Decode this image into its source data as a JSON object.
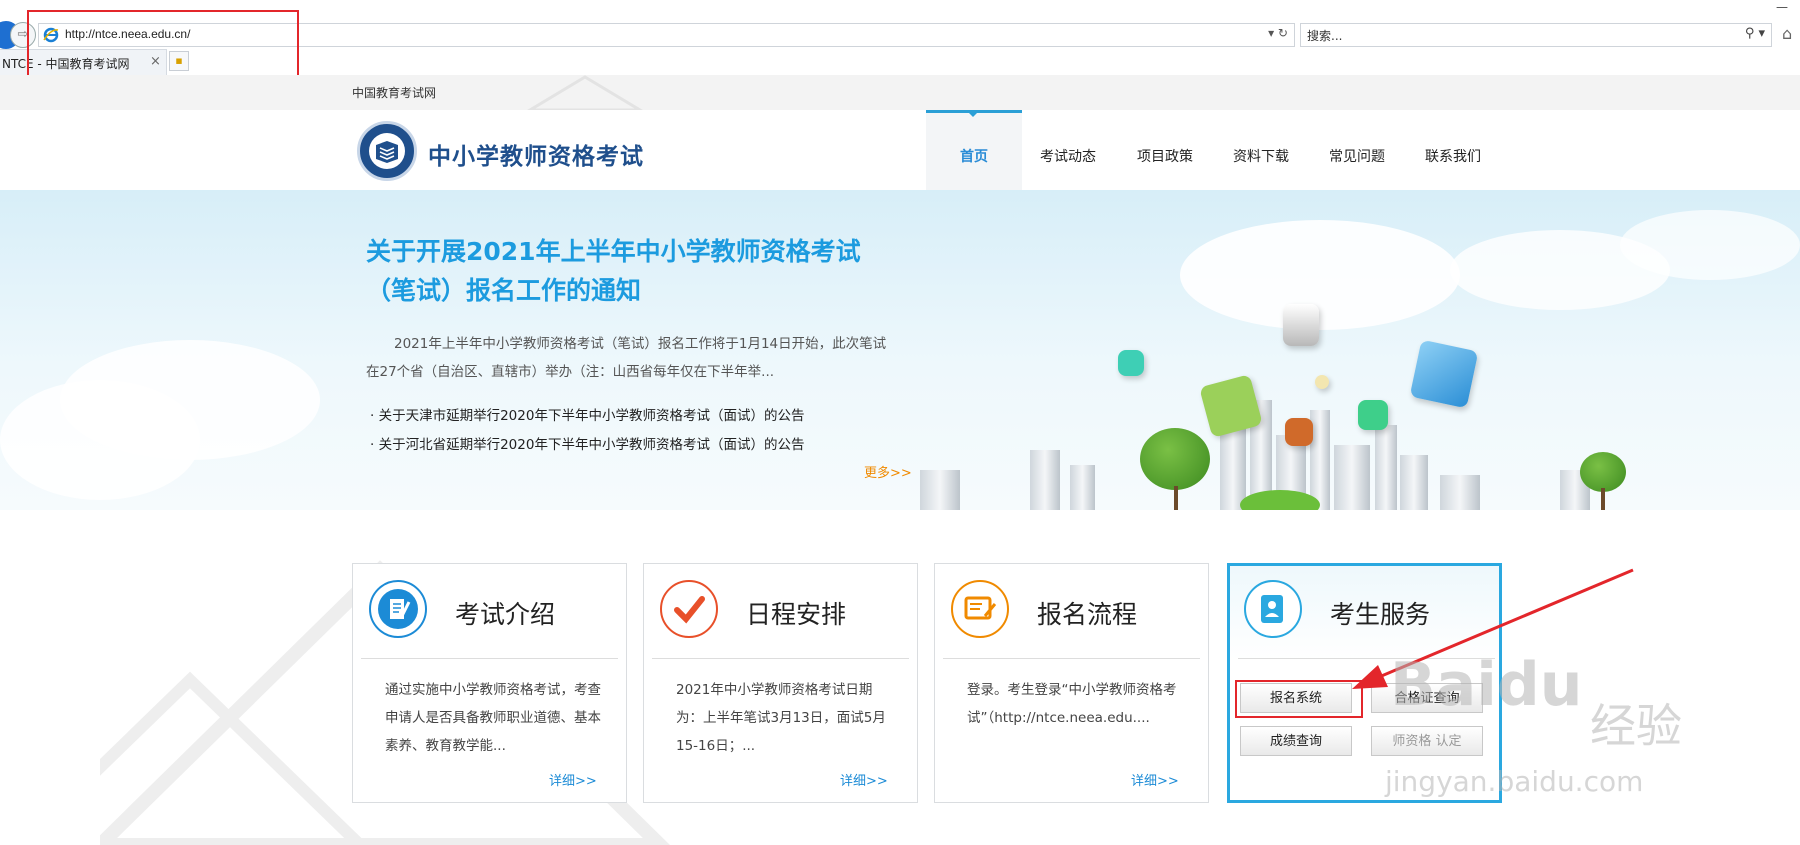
{
  "browser": {
    "url": "http://ntce.neea.edu.cn/",
    "addr_tools": "▾ ↻",
    "search_placeholder": "搜索...",
    "search_tools": "⚲ ▾",
    "tab_title": "NTCE - 中国教育考试网",
    "tab_close": "×"
  },
  "site": {
    "top_label": "中国教育考试网",
    "title": "中小学教师资格考试",
    "nav": [
      "首页",
      "考试动态",
      "项目政策",
      "资料下载",
      "常见问题",
      "联系我们"
    ]
  },
  "banner": {
    "headline": "关于开展2021年上半年中小学教师资格考试（笔试）报名工作的通知",
    "body": "2021年上半年中小学教师资格考试（笔试）报名工作将于1月14日开始，此次笔试在27个省（自治区、直辖市）举办（注：山西省每年仅在下半年举...",
    "items": [
      "· 关于天津市延期举行2020年下半年中小学教师资格考试（面试）的公告",
      "· 关于河北省延期举行2020年下半年中小学教师资格考试（面试）的公告"
    ],
    "more": "更多>>"
  },
  "cards": [
    {
      "title": "考试介绍",
      "text": "通过实施中小学教师资格考试，考查申请人是否具备教师职业道德、基本素养、教育教学能...",
      "more": "详细>>",
      "color": "#1c8bd6"
    },
    {
      "title": "日程安排",
      "text": "2021年中小学教师资格考试日期为：上半年笔试3月13日，面试5月15-16日；...",
      "more": "详细>>",
      "color": "#e8502a"
    },
    {
      "title": "报名流程",
      "text": "登录。考生登录“中小学教师资格考试”（http://ntce.neea.edu....",
      "more": "详细>>",
      "color": "#f08a00"
    },
    {
      "title": "考生服务",
      "color": "#2aa8e0"
    }
  ],
  "service_buttons": {
    "register": "报名系统",
    "admission": "合格证查询",
    "score": "成绩查询",
    "cert": "师资格 认定"
  },
  "watermark": {
    "logo": "Baidu",
    "cn": "经验",
    "url": "jingyan.baidu.com"
  },
  "colors": {
    "accent": "#2a9fd6",
    "highlight_red": "#e3262b",
    "brand_blue": "#1f4f8c"
  }
}
